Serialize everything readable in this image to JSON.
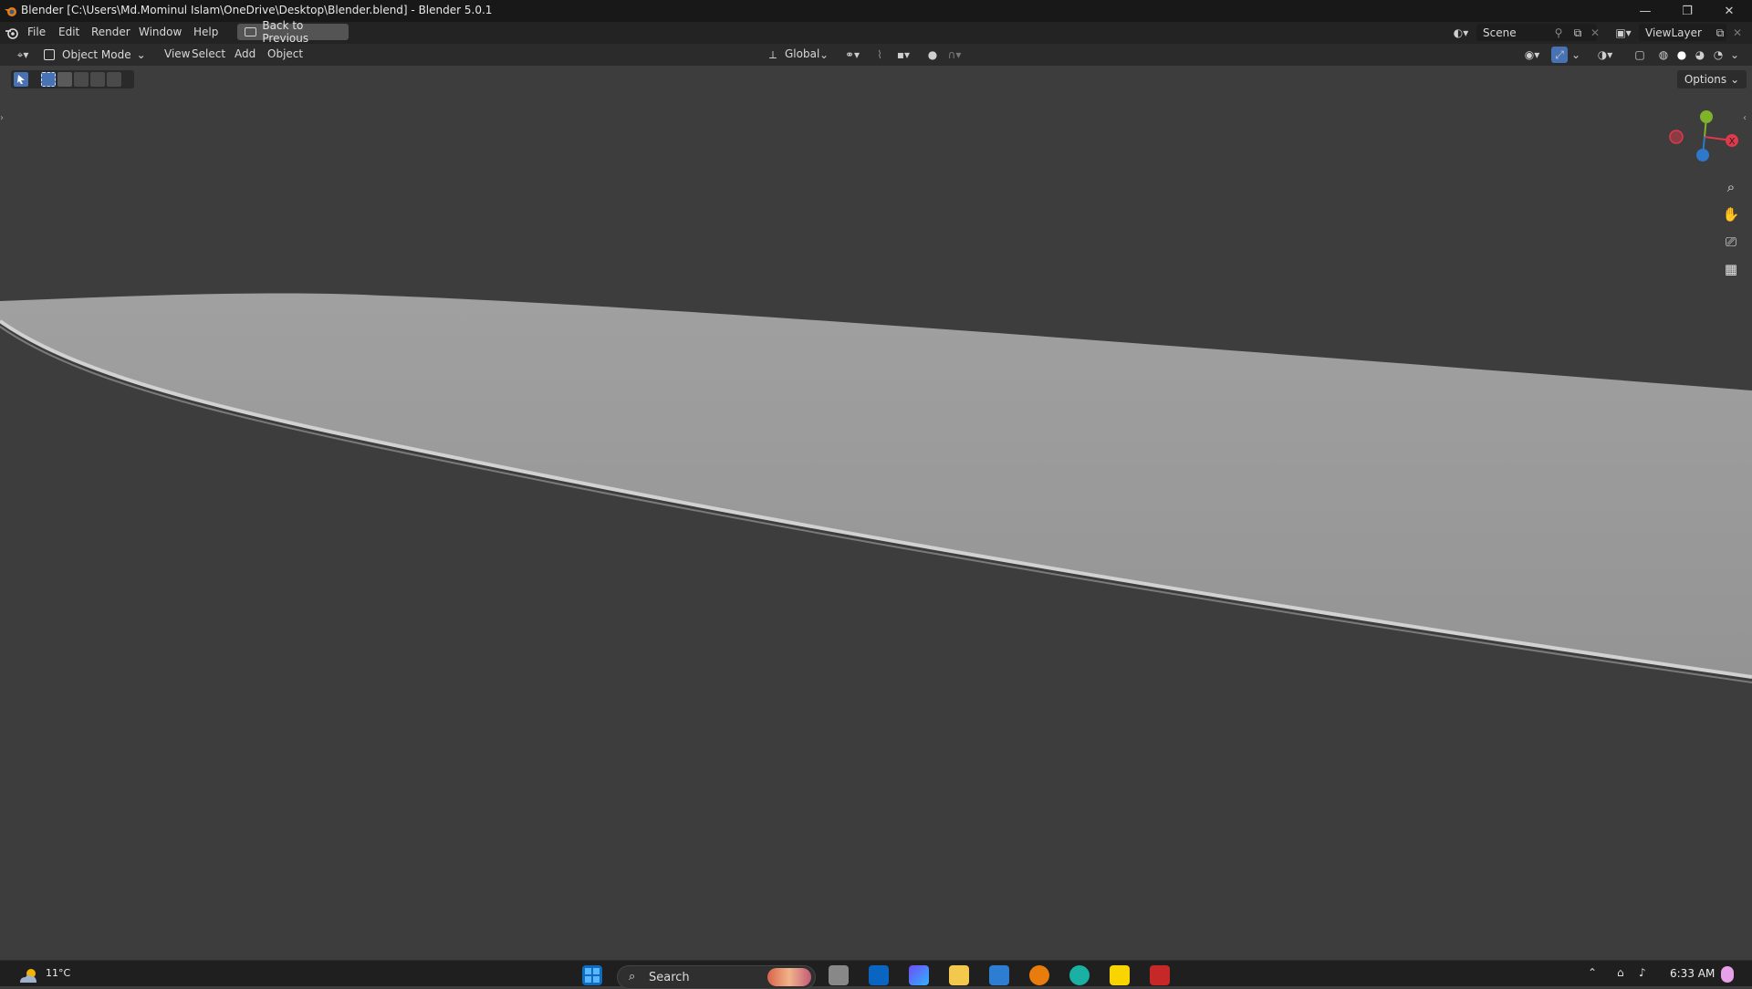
{
  "window": {
    "title": "Blender [C:\\Users\\Md.Mominul Islam\\OneDrive\\Desktop\\Blender.blend] - Blender 5.0.1",
    "controls": [
      "minimize",
      "maximize",
      "close"
    ]
  },
  "menubar": {
    "items": [
      "File",
      "Edit",
      "Render",
      "Window",
      "Help"
    ],
    "back_button": "Back to Previous",
    "scene_name": "Scene",
    "view_layer": "ViewLayer"
  },
  "viewport_header": {
    "mode": "Object Mode",
    "menus": [
      "View",
      "Select",
      "Add",
      "Object"
    ],
    "orientation": "Global"
  },
  "tool_settings": {
    "options_label": "Options"
  },
  "gizmo": {
    "axes": [
      {
        "label": "X",
        "color": "#e0394b"
      },
      {
        "label": "Y",
        "color": "#7fb32a"
      },
      {
        "label": "Z",
        "color": "#2e78c9"
      }
    ]
  },
  "navigation": {
    "buttons": [
      "zoom-icon",
      "pan-hand-icon",
      "camera-view-icon",
      "perspective-grid-icon"
    ]
  },
  "taskbar": {
    "weather_temp": "11°C",
    "search_placeholder": "Search",
    "time": "6:33 AM"
  },
  "colors": {
    "viewport_bg": "#3d3d3d",
    "object_fill": "#999999",
    "accent_blue": "#4772b3"
  }
}
